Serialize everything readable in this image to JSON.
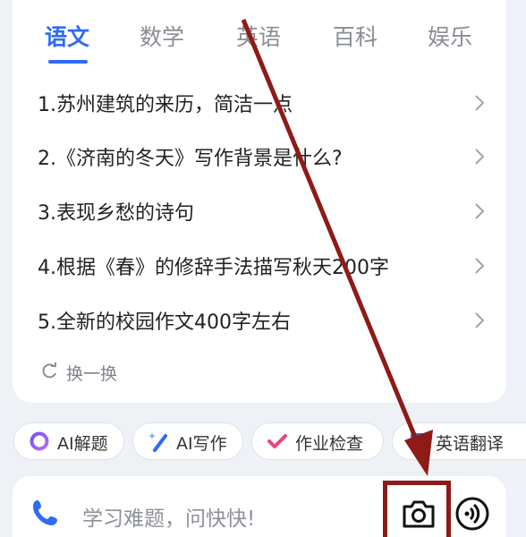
{
  "tabs": [
    {
      "label": "语文",
      "active": true
    },
    {
      "label": "数学",
      "active": false
    },
    {
      "label": "英语",
      "active": false
    },
    {
      "label": "百科",
      "active": false
    },
    {
      "label": "娱乐",
      "active": false
    }
  ],
  "questions": [
    {
      "text": "1.苏州建筑的来历，简洁一点"
    },
    {
      "text": "2.《济南的冬天》写作背景是什么?"
    },
    {
      "text": "3.表现乡愁的诗句"
    },
    {
      "text": "4.根据《春》的修辞手法描写秋天200字"
    },
    {
      "text": "5.全新的校园作文400字左右"
    }
  ],
  "refresh": {
    "label": "换一换",
    "icon": "refresh-icon"
  },
  "chips": [
    {
      "label": "AI解题",
      "icon": "ring-icon"
    },
    {
      "label": "AI写作",
      "icon": "pen-sparkle-icon"
    },
    {
      "label": "作业检查",
      "icon": "check-icon"
    },
    {
      "label": "英语翻译",
      "icon": "translate-icon"
    }
  ],
  "input": {
    "placeholder": "学习难题，问快快!"
  },
  "colors": {
    "accent": "#2f6bf5",
    "annotation": "#8e1b17"
  }
}
